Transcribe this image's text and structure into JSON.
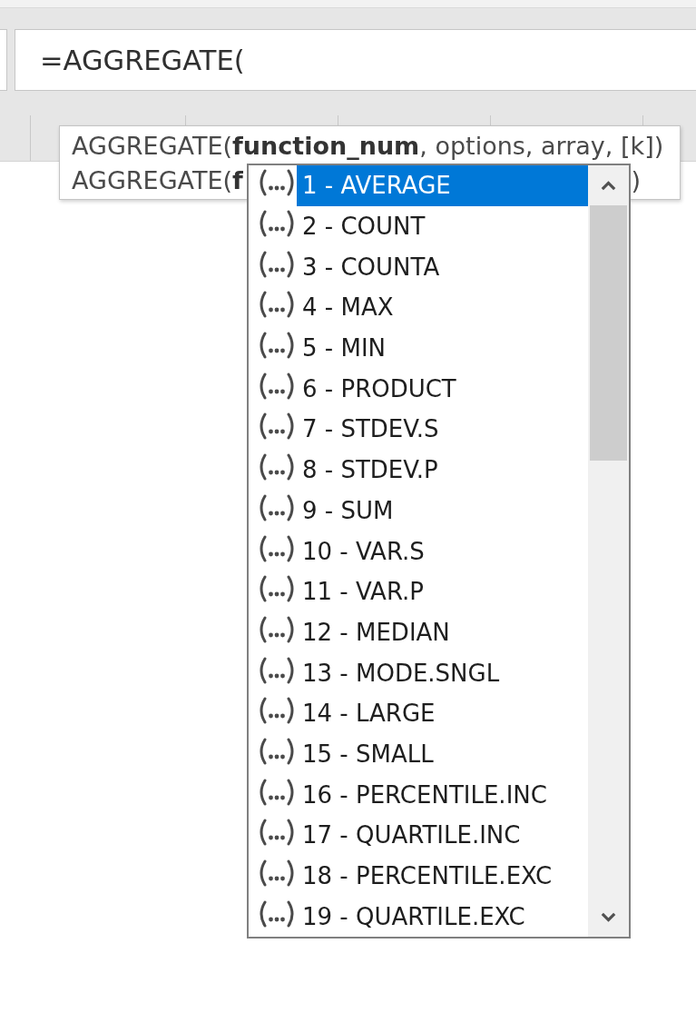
{
  "formula_bar": {
    "value": "=AGGREGATE("
  },
  "tooltip": {
    "signatures": [
      {
        "text": "AGGREGATE(**function_num**, options, array, [k])"
      },
      {
        "text": "AGGREGATE(**f**",
        "tail": ")"
      }
    ]
  },
  "dropdown": {
    "items": [
      {
        "label": "1 - AVERAGE",
        "selected": true
      },
      {
        "label": "2 - COUNT",
        "selected": false
      },
      {
        "label": "3 - COUNTA",
        "selected": false
      },
      {
        "label": "4 - MAX",
        "selected": false
      },
      {
        "label": "5 - MIN",
        "selected": false
      },
      {
        "label": "6 - PRODUCT",
        "selected": false
      },
      {
        "label": "7 - STDEV.S",
        "selected": false
      },
      {
        "label": "8 - STDEV.P",
        "selected": false
      },
      {
        "label": "9 - SUM",
        "selected": false
      },
      {
        "label": "10 - VAR.S",
        "selected": false
      },
      {
        "label": "11 - VAR.P",
        "selected": false
      },
      {
        "label": "12 - MEDIAN",
        "selected": false
      },
      {
        "label": "13 - MODE.SNGL",
        "selected": false
      },
      {
        "label": "14 - LARGE",
        "selected": false
      },
      {
        "label": "15 - SMALL",
        "selected": false
      },
      {
        "label": "16 - PERCENTILE.INC",
        "selected": false
      },
      {
        "label": "17 - QUARTILE.INC",
        "selected": false
      },
      {
        "label": "18 - PERCENTILE.EXC",
        "selected": false
      },
      {
        "label": "19 - QUARTILE.EXC",
        "selected": false
      }
    ]
  }
}
